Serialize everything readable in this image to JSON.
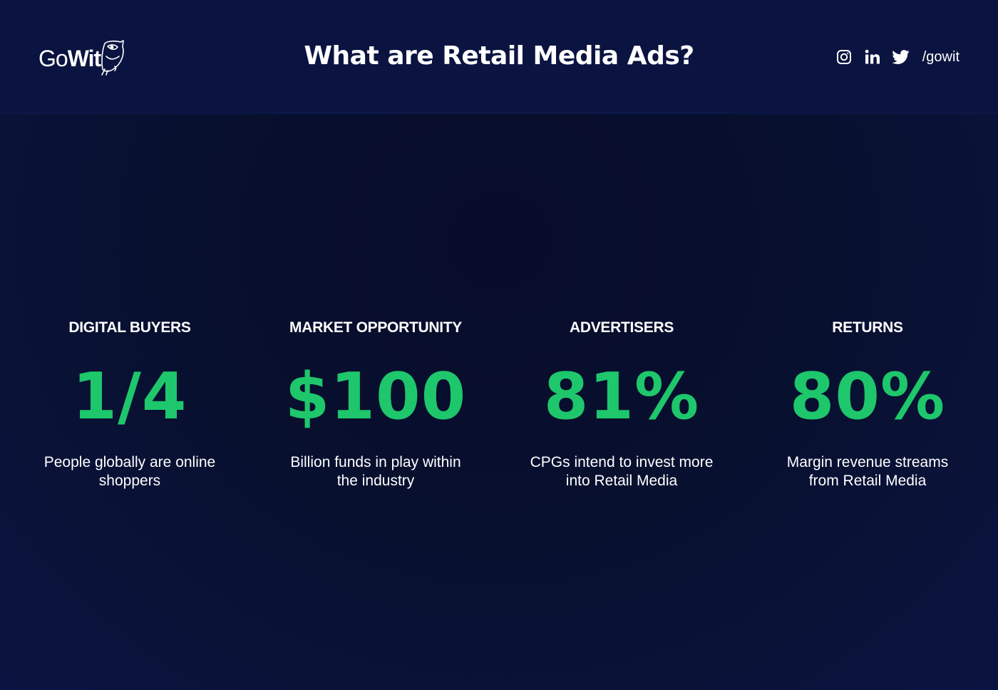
{
  "header": {
    "logo": {
      "part1": "Go",
      "part2": "Wit",
      "icon": "owl-icon"
    },
    "title": "What are Retail Media Ads?",
    "socials": [
      {
        "icon": "instagram-icon"
      },
      {
        "icon": "linkedin-icon"
      },
      {
        "icon": "twitter-icon"
      }
    ],
    "handle": "/gowit"
  },
  "stats": [
    {
      "label": "DIGITAL BUYERS",
      "value": "1/4",
      "description": "People globally are online shoppers"
    },
    {
      "label": "MARKET OPPORTUNITY",
      "value": "$100",
      "description": "Billion funds in play within the industry"
    },
    {
      "label": "ADVERTISERS",
      "value": "81%",
      "description": "CPGs intend to invest more into Retail Media"
    },
    {
      "label": "RETURNS",
      "value": "80%",
      "description": "Margin revenue streams from Retail Media"
    }
  ],
  "colors": {
    "background": "#08102f",
    "header": "#0b1440",
    "accent": "#1ec76b",
    "text": "#ffffff"
  }
}
